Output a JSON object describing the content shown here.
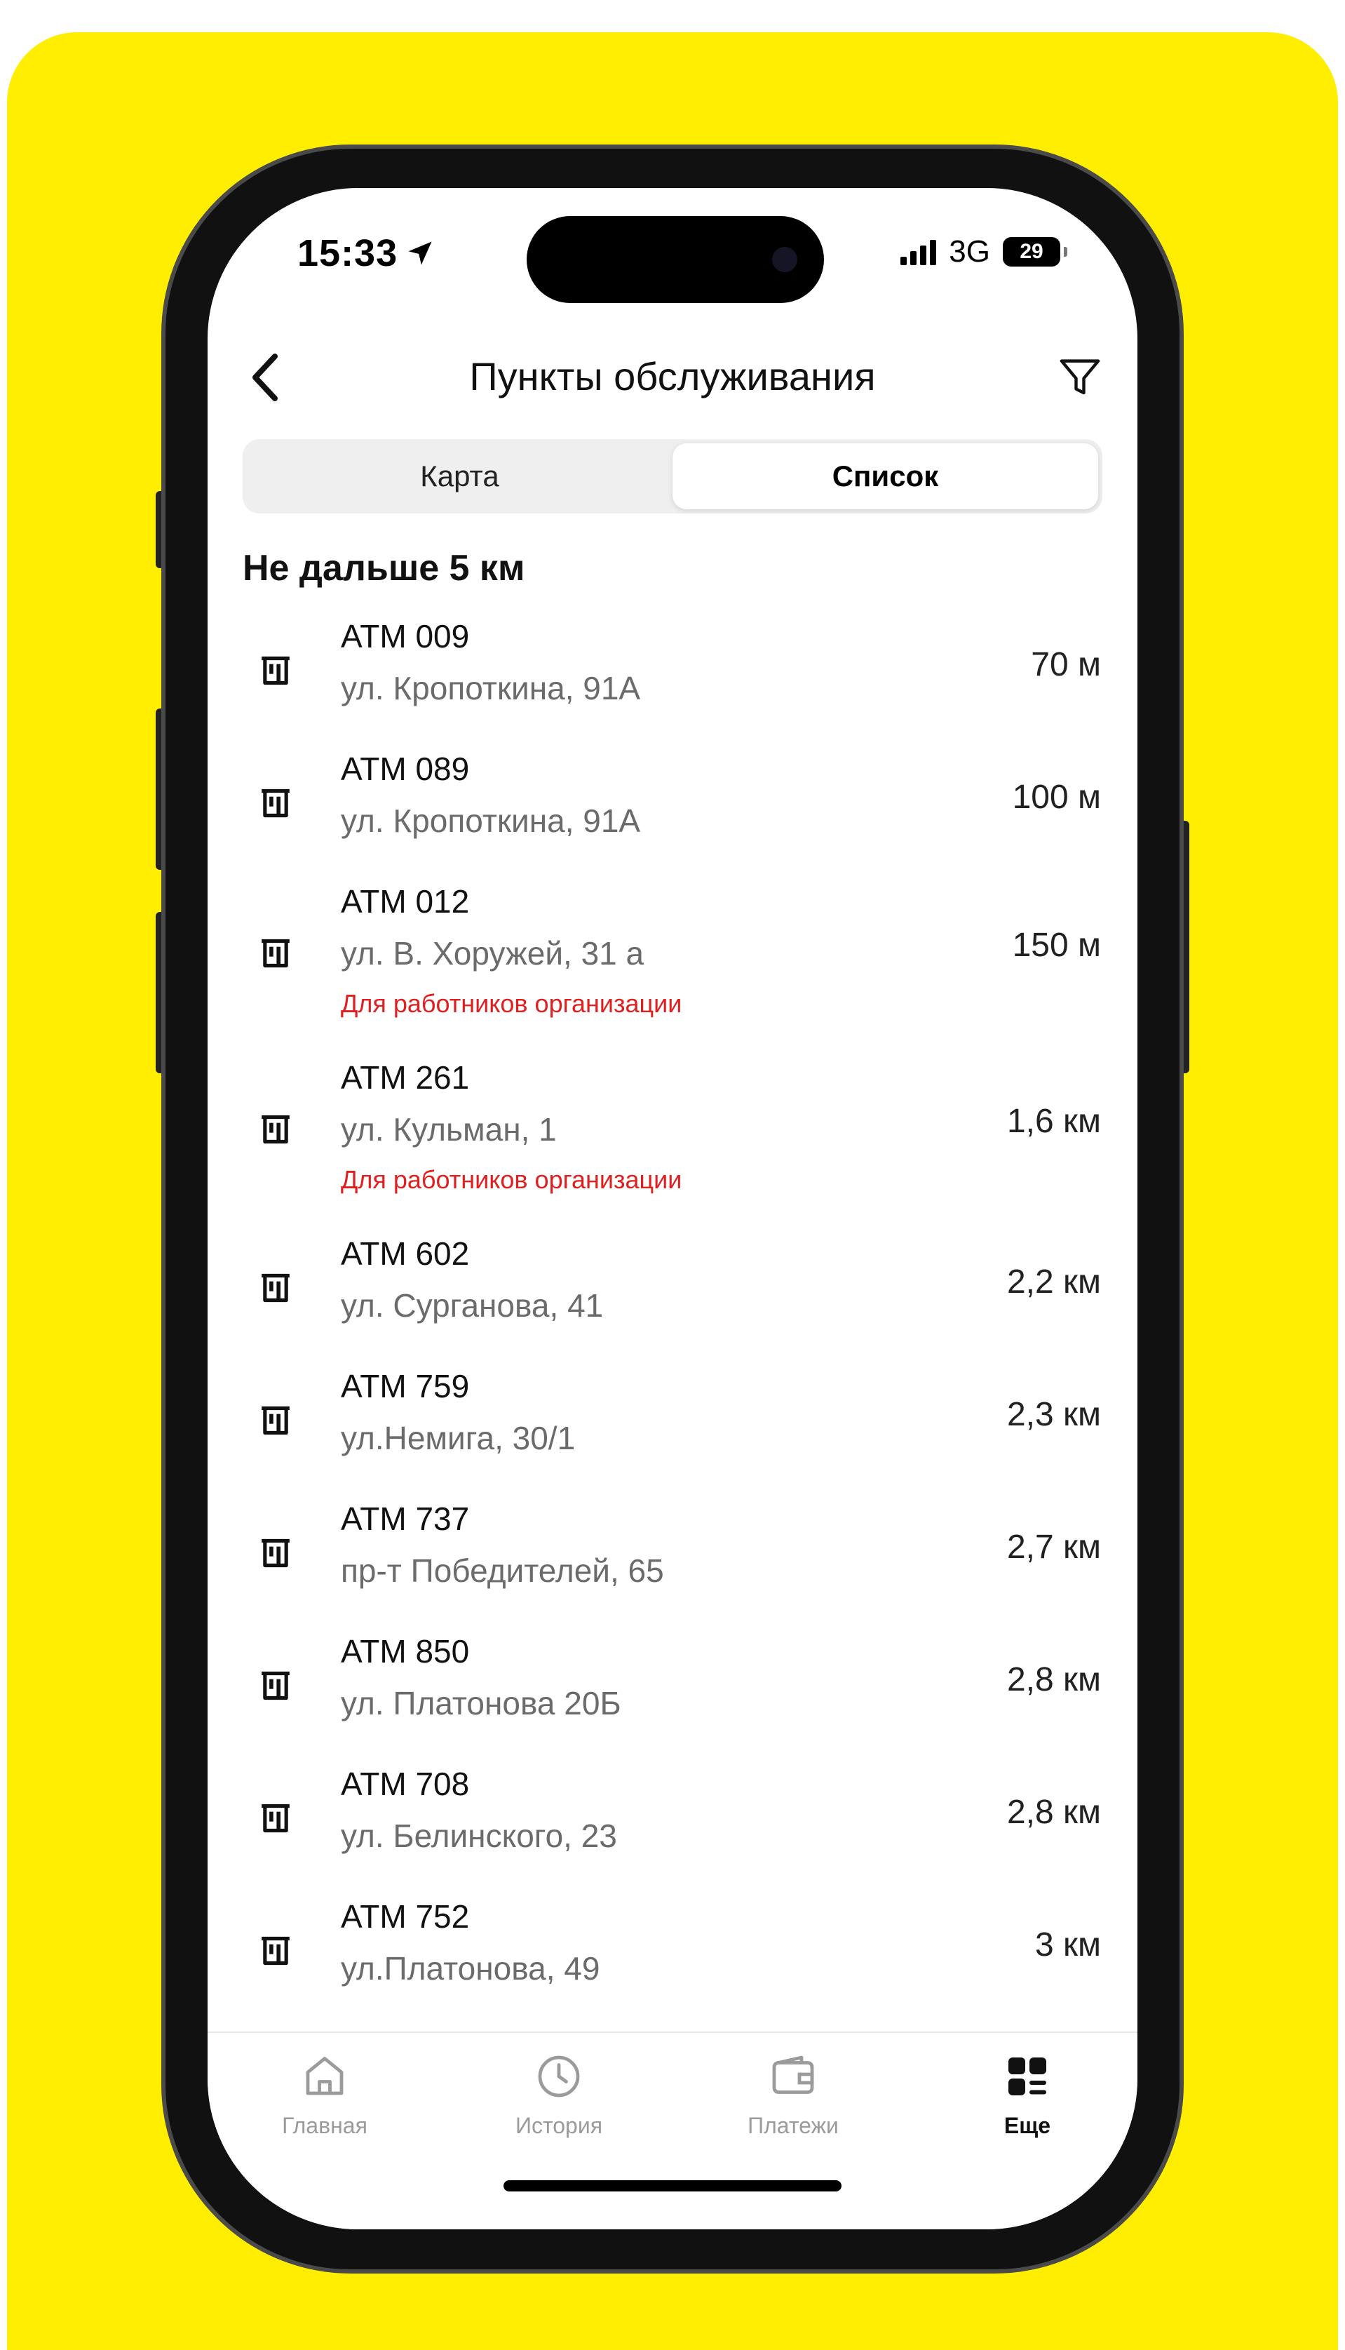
{
  "status_bar": {
    "time": "15:33",
    "network": "3G",
    "battery": "29"
  },
  "header": {
    "title": "Пункты обслуживания",
    "back_icon": "chevron-left-icon",
    "filter_icon": "funnel-filter-icon"
  },
  "segmented": {
    "map_label": "Карта",
    "list_label": "Список",
    "selected": "Список"
  },
  "section_title": "Не дальше 5 км",
  "atms": [
    {
      "name": "ATM 009",
      "address": "ул. Кропоткина, 91А",
      "note": "",
      "distance": "70 м"
    },
    {
      "name": "ATM 089",
      "address": "ул. Кропоткина, 91А",
      "note": "",
      "distance": "100 м"
    },
    {
      "name": "ATM 012",
      "address": "ул. В. Хоружей, 31 а",
      "note": "Для работников организации",
      "distance": "150 м"
    },
    {
      "name": "ATM 261",
      "address": "ул. Кульман, 1",
      "note": "Для работников организации",
      "distance": "1,6 км"
    },
    {
      "name": "ATM 602",
      "address": "ул. Сурганова, 41",
      "note": "",
      "distance": "2,2 км"
    },
    {
      "name": "ATM 759",
      "address": "ул.Немига, 30/1",
      "note": "",
      "distance": "2,3 км"
    },
    {
      "name": "ATM 737",
      "address": "пр-т Победителей, 65",
      "note": "",
      "distance": "2,7 км"
    },
    {
      "name": "ATM 850",
      "address": "ул. Платонова 20Б",
      "note": "",
      "distance": "2,8 км"
    },
    {
      "name": "ATM 708",
      "address": "ул. Белинского, 23",
      "note": "",
      "distance": "2,8 км"
    },
    {
      "name": "ATM 752",
      "address": "ул.Платонова, 49",
      "note": "",
      "distance": "3 км"
    }
  ],
  "tabs": [
    {
      "label": "Главная",
      "icon": "home-icon"
    },
    {
      "label": "История",
      "icon": "clock-history-icon"
    },
    {
      "label": "Платежи",
      "icon": "wallet-icon"
    },
    {
      "label": "Еще",
      "icon": "grid-menu-icon"
    }
  ],
  "active_tab": "Еще",
  "colors": {
    "background": "#FFEE00",
    "note_red": "#E02020",
    "text_primary": "#111111",
    "text_secondary": "#6B6B6B",
    "tab_inactive": "#9B9B9B"
  }
}
